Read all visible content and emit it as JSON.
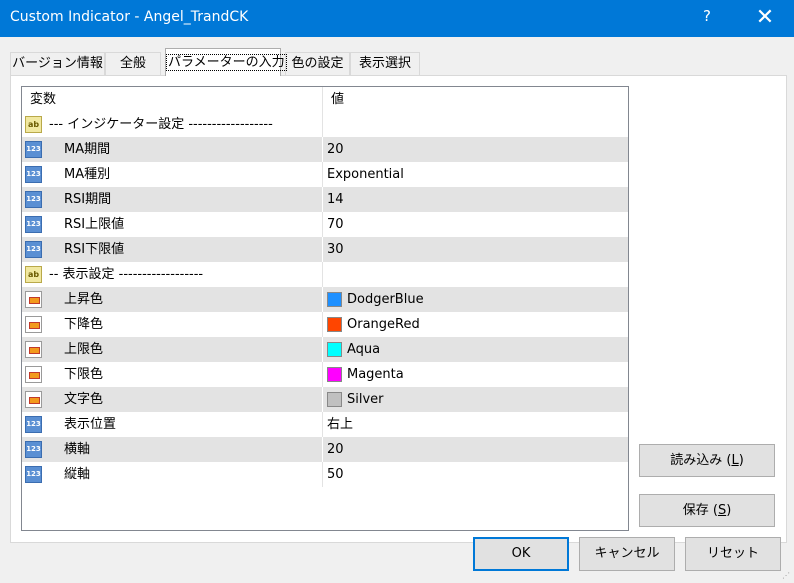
{
  "window": {
    "title": "Custom Indicator - Angel_TrandCK",
    "help": "?",
    "close": "✕"
  },
  "tabs": [
    {
      "label": "バージョン情報"
    },
    {
      "label": "全般"
    },
    {
      "label": "パラメーターの入力"
    },
    {
      "label": "色の設定"
    },
    {
      "label": "表示選択"
    }
  ],
  "grid": {
    "header": {
      "name": "変数",
      "value": "値"
    },
    "rows": [
      {
        "icon": "string-icon",
        "label": "--- インジケーター設定 ------------------",
        "value": ""
      },
      {
        "icon": "number-icon",
        "label": "MA期間",
        "value": "20"
      },
      {
        "icon": "number-icon",
        "label": "MA種別",
        "value": "Exponential"
      },
      {
        "icon": "number-icon",
        "label": "RSI期間",
        "value": "14"
      },
      {
        "icon": "number-icon",
        "label": "RSI上限値",
        "value": "70"
      },
      {
        "icon": "number-icon",
        "label": "RSI下限値",
        "value": "30"
      },
      {
        "icon": "string-icon",
        "label": "-- 表示設定 ------------------",
        "value": ""
      },
      {
        "icon": "color-icon",
        "label": "上昇色",
        "value": "DodgerBlue",
        "color": "#1e90ff"
      },
      {
        "icon": "color-icon",
        "label": "下降色",
        "value": "OrangeRed",
        "color": "#ff4500"
      },
      {
        "icon": "color-icon",
        "label": "上限色",
        "value": "Aqua",
        "color": "#00ffff"
      },
      {
        "icon": "color-icon",
        "label": "下限色",
        "value": "Magenta",
        "color": "#ff00ff"
      },
      {
        "icon": "color-icon",
        "label": "文字色",
        "value": "Silver",
        "color": "#c0c0c0"
      },
      {
        "icon": "number-icon",
        "label": "表示位置",
        "value": "右上"
      },
      {
        "icon": "number-icon",
        "label": "横軸",
        "value": "20"
      },
      {
        "icon": "number-icon",
        "label": "縦軸",
        "value": "50"
      }
    ]
  },
  "buttons": {
    "load": {
      "text": "読み込み (",
      "key": "L",
      "end": ")"
    },
    "save": {
      "text": "保存 (",
      "key": "S",
      "end": ")"
    },
    "ok": "OK",
    "cancel": "キャンセル",
    "reset": "リセット"
  },
  "icons": {
    "ab": "ab",
    "num": "123"
  },
  "colors": {
    "titlebar": "#0078d7",
    "default_button_border": "#0078d7"
  }
}
